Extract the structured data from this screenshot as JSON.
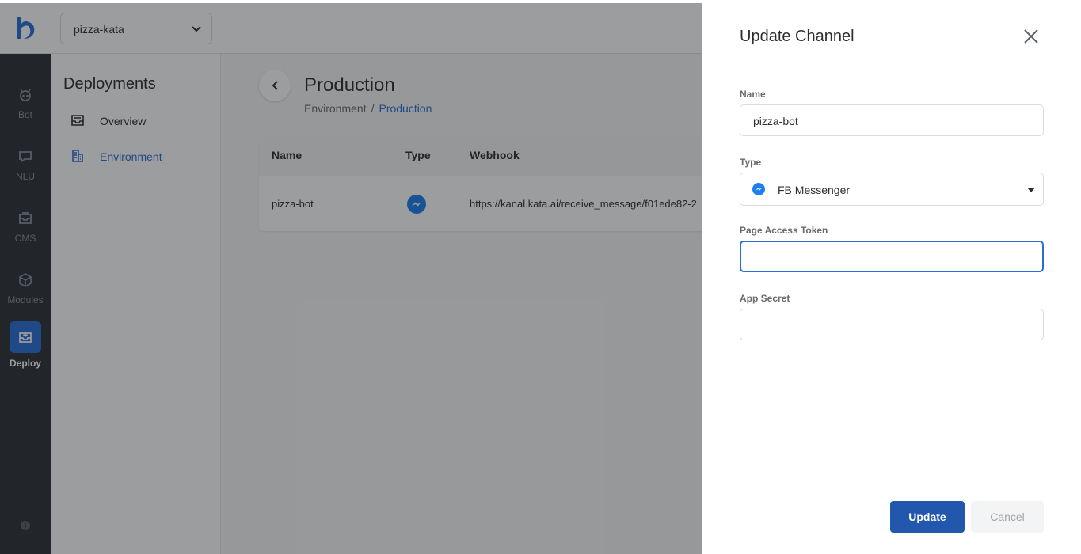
{
  "app": {
    "bot_selector": {
      "value": "pizza-kata"
    }
  },
  "rail": {
    "items": [
      {
        "label": "Bot",
        "icon": "bot-icon"
      },
      {
        "label": "NLU",
        "icon": "chat-icon"
      },
      {
        "label": "CMS",
        "icon": "cms-icon"
      },
      {
        "label": "Modules",
        "icon": "cube-icon"
      },
      {
        "label": "Deploy",
        "icon": "deploy-icon",
        "active": true
      }
    ]
  },
  "subnav": {
    "title": "Deployments",
    "items": [
      {
        "label": "Overview",
        "icon": "inbox-icon"
      },
      {
        "label": "Environment",
        "icon": "building-icon",
        "active": true
      }
    ]
  },
  "main": {
    "title": "Production",
    "breadcrumb": {
      "parent": "Environment",
      "separator": "/",
      "current": "Production"
    },
    "table": {
      "columns": [
        "Name",
        "Type",
        "Webhook"
      ],
      "rows": [
        {
          "name": "pizza-bot",
          "type_icon": "messenger-icon",
          "webhook": "https://kanal.kata.ai/receive_message/f01ede82-2"
        }
      ]
    }
  },
  "drawer": {
    "title": "Update Channel",
    "fields": {
      "name": {
        "label": "Name",
        "value": "pizza-bot"
      },
      "type": {
        "label": "Type",
        "value": "FB Messenger",
        "icon": "messenger-icon"
      },
      "page_access_token": {
        "label": "Page Access Token",
        "value": ""
      },
      "app_secret": {
        "label": "App Secret",
        "value": ""
      }
    },
    "buttons": {
      "update": "Update",
      "cancel": "Cancel"
    }
  },
  "colors": {
    "accent": "#2a6fd8",
    "primary_button": "#2257ae",
    "rail": "#2d3237",
    "messenger": "#1e7ff0"
  }
}
